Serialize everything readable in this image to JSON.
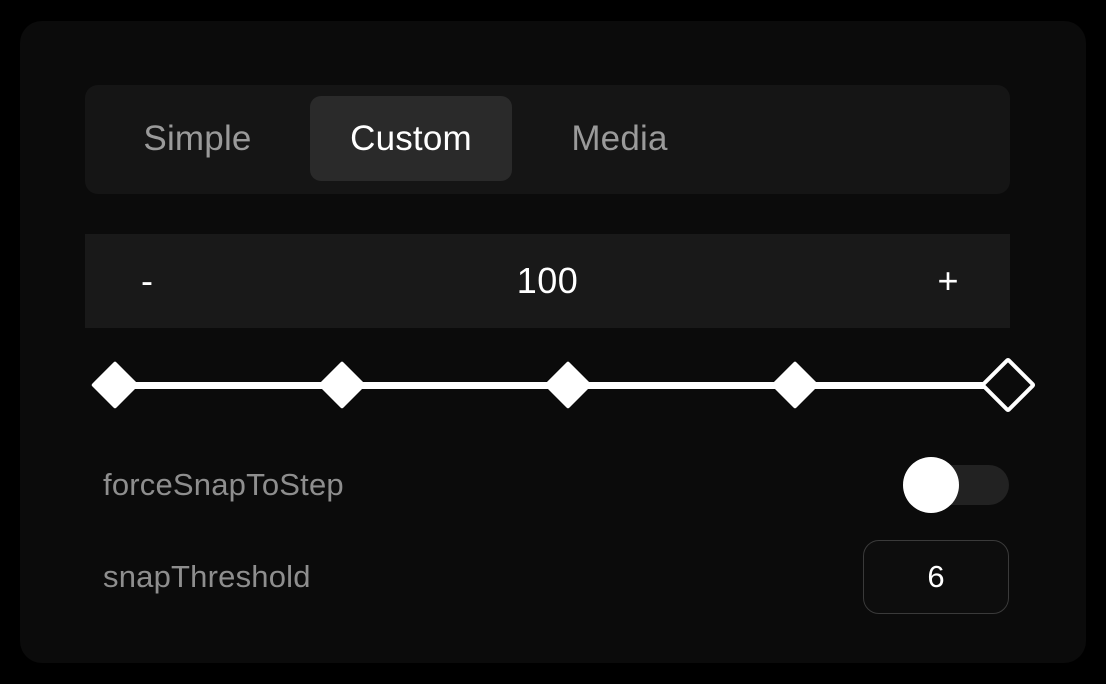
{
  "card": {
    "background_color": "#0b0b0b"
  },
  "tabs": {
    "items": [
      {
        "label": "Simple",
        "active": false
      },
      {
        "label": "Custom",
        "active": true
      },
      {
        "label": "Media",
        "active": false
      }
    ],
    "active_background_color": "#2a2a2a",
    "inactive_text_color": "#9a9a9a",
    "active_text_color": "#ffffff"
  },
  "stepper": {
    "decrement_label": "-",
    "increment_label": "+",
    "value": "100",
    "background_color": "#191919"
  },
  "slider": {
    "tick_count": 5,
    "tick_positions_percent": [
      0,
      25,
      50,
      75,
      100
    ],
    "thumb_position_percent": 100,
    "track_color": "#ffffff",
    "tick_color": "#ffffff",
    "thumb_fill_color": "#0b0b0b",
    "thumb_stroke_color": "#ffffff",
    "thumb_shape": "diamond-outline",
    "tick_shape": "diamond-filled"
  },
  "settings": {
    "force_snap_to_step": {
      "label": "forceSnapToStep",
      "value": "on",
      "knob_color": "#ffffff",
      "track_color": "#222222"
    },
    "snap_threshold": {
      "label": "snapThreshold",
      "value": "6",
      "border_color": "#3a3a3a"
    }
  }
}
